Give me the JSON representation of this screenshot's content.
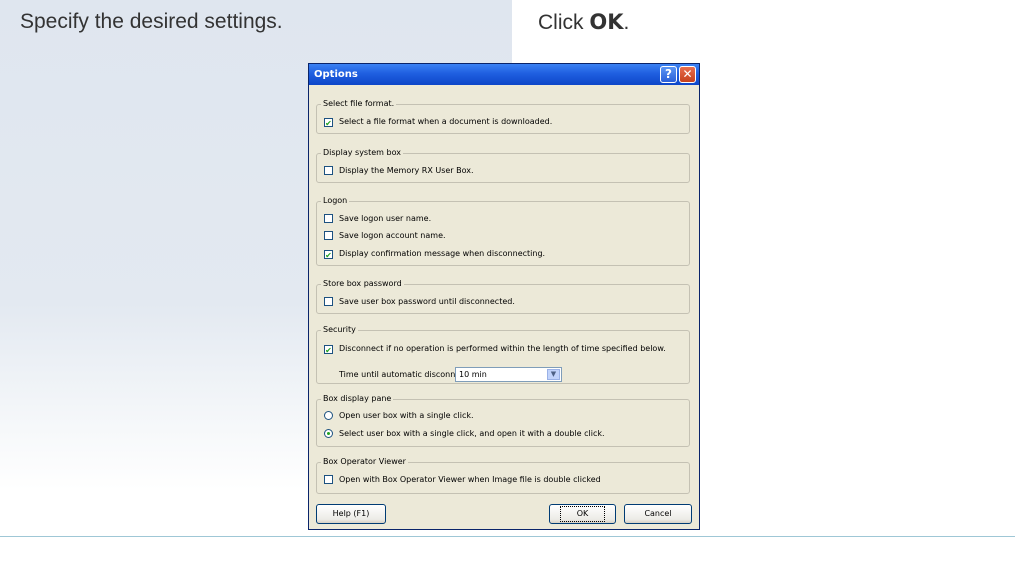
{
  "instructions": {
    "left": "Specify the desired settings.",
    "right_prefix": "Click ",
    "right_bold": "OK",
    "right_suffix": "."
  },
  "dialog": {
    "title": "Options",
    "help_title_button": "?",
    "close_title_button": "✕",
    "groups": [
      {
        "title": "Select file format.",
        "items": [
          {
            "type": "checkbox",
            "label": "Select a file format when a document is downloaded.",
            "checked": true
          }
        ]
      },
      {
        "title": "Display system box",
        "items": [
          {
            "type": "checkbox",
            "label": "Display the Memory RX User Box.",
            "checked": false
          }
        ]
      },
      {
        "title": "Logon",
        "items": [
          {
            "type": "checkbox",
            "label": "Save logon user name.",
            "checked": false
          },
          {
            "type": "checkbox",
            "label": "Save logon account name.",
            "checked": false
          },
          {
            "type": "checkbox",
            "label": "Display confirmation message when disconnecting.",
            "checked": true
          }
        ]
      },
      {
        "title": "Store box password",
        "items": [
          {
            "type": "checkbox",
            "label": "Save user box password until disconnected.",
            "checked": false
          }
        ]
      },
      {
        "title": "Security",
        "items": [
          {
            "type": "checkbox",
            "label": "Disconnect if no operation is performed within the length of time specified below.",
            "checked": true
          }
        ],
        "timeout_label": "Time until automatic disconnect:",
        "timeout_value": "10 min"
      },
      {
        "title": "Box display pane",
        "items": [
          {
            "type": "radio",
            "label": "Open user box with a single click.",
            "checked": false
          },
          {
            "type": "radio",
            "label": "Select user box with a single click, and open it with a double click.",
            "checked": true
          }
        ]
      },
      {
        "title": "Box Operator Viewer",
        "items": [
          {
            "type": "checkbox",
            "label": "Open with Box Operator Viewer when Image file is double clicked",
            "checked": false
          }
        ]
      }
    ],
    "buttons": {
      "help": "Help (F1)",
      "ok": "OK",
      "cancel": "Cancel"
    }
  }
}
